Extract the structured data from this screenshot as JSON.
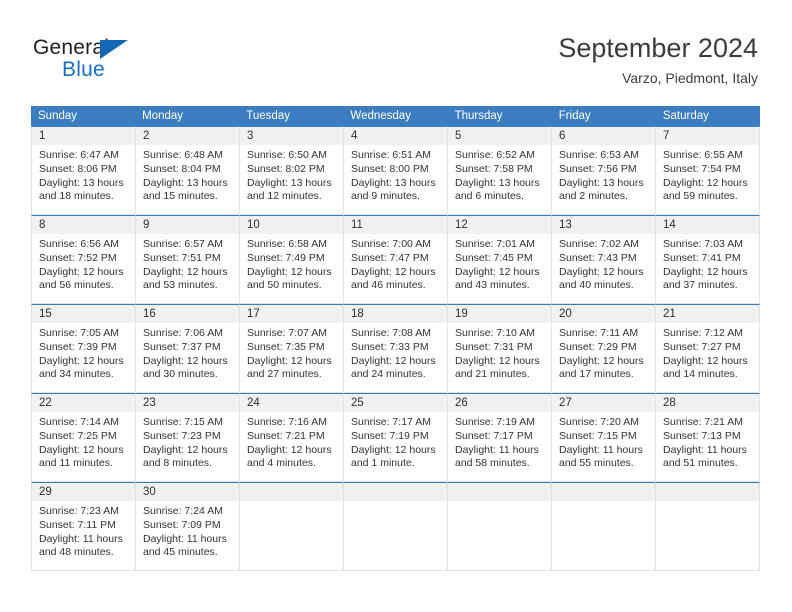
{
  "brand": {
    "name_part1": "General",
    "name_part2": "Blue",
    "triangle_color": "#1565b8"
  },
  "header": {
    "title": "September 2024",
    "location": "Varzo, Piedmont, Italy"
  },
  "colors": {
    "header_blue": "#3b7dc0",
    "daynum_band": "#f1f1f1",
    "border": "#e2e2e2"
  },
  "weekdays": [
    "Sunday",
    "Monday",
    "Tuesday",
    "Wednesday",
    "Thursday",
    "Friday",
    "Saturday"
  ],
  "weeks": [
    [
      {
        "day": "1",
        "sunrise": "Sunrise: 6:47 AM",
        "sunset": "Sunset: 8:06 PM",
        "daylight1": "Daylight: 13 hours",
        "daylight2": "and 18 minutes."
      },
      {
        "day": "2",
        "sunrise": "Sunrise: 6:48 AM",
        "sunset": "Sunset: 8:04 PM",
        "daylight1": "Daylight: 13 hours",
        "daylight2": "and 15 minutes."
      },
      {
        "day": "3",
        "sunrise": "Sunrise: 6:50 AM",
        "sunset": "Sunset: 8:02 PM",
        "daylight1": "Daylight: 13 hours",
        "daylight2": "and 12 minutes."
      },
      {
        "day": "4",
        "sunrise": "Sunrise: 6:51 AM",
        "sunset": "Sunset: 8:00 PM",
        "daylight1": "Daylight: 13 hours",
        "daylight2": "and 9 minutes."
      },
      {
        "day": "5",
        "sunrise": "Sunrise: 6:52 AM",
        "sunset": "Sunset: 7:58 PM",
        "daylight1": "Daylight: 13 hours",
        "daylight2": "and 6 minutes."
      },
      {
        "day": "6",
        "sunrise": "Sunrise: 6:53 AM",
        "sunset": "Sunset: 7:56 PM",
        "daylight1": "Daylight: 13 hours",
        "daylight2": "and 2 minutes."
      },
      {
        "day": "7",
        "sunrise": "Sunrise: 6:55 AM",
        "sunset": "Sunset: 7:54 PM",
        "daylight1": "Daylight: 12 hours",
        "daylight2": "and 59 minutes."
      }
    ],
    [
      {
        "day": "8",
        "sunrise": "Sunrise: 6:56 AM",
        "sunset": "Sunset: 7:52 PM",
        "daylight1": "Daylight: 12 hours",
        "daylight2": "and 56 minutes."
      },
      {
        "day": "9",
        "sunrise": "Sunrise: 6:57 AM",
        "sunset": "Sunset: 7:51 PM",
        "daylight1": "Daylight: 12 hours",
        "daylight2": "and 53 minutes."
      },
      {
        "day": "10",
        "sunrise": "Sunrise: 6:58 AM",
        "sunset": "Sunset: 7:49 PM",
        "daylight1": "Daylight: 12 hours",
        "daylight2": "and 50 minutes."
      },
      {
        "day": "11",
        "sunrise": "Sunrise: 7:00 AM",
        "sunset": "Sunset: 7:47 PM",
        "daylight1": "Daylight: 12 hours",
        "daylight2": "and 46 minutes."
      },
      {
        "day": "12",
        "sunrise": "Sunrise: 7:01 AM",
        "sunset": "Sunset: 7:45 PM",
        "daylight1": "Daylight: 12 hours",
        "daylight2": "and 43 minutes."
      },
      {
        "day": "13",
        "sunrise": "Sunrise: 7:02 AM",
        "sunset": "Sunset: 7:43 PM",
        "daylight1": "Daylight: 12 hours",
        "daylight2": "and 40 minutes."
      },
      {
        "day": "14",
        "sunrise": "Sunrise: 7:03 AM",
        "sunset": "Sunset: 7:41 PM",
        "daylight1": "Daylight: 12 hours",
        "daylight2": "and 37 minutes."
      }
    ],
    [
      {
        "day": "15",
        "sunrise": "Sunrise: 7:05 AM",
        "sunset": "Sunset: 7:39 PM",
        "daylight1": "Daylight: 12 hours",
        "daylight2": "and 34 minutes."
      },
      {
        "day": "16",
        "sunrise": "Sunrise: 7:06 AM",
        "sunset": "Sunset: 7:37 PM",
        "daylight1": "Daylight: 12 hours",
        "daylight2": "and 30 minutes."
      },
      {
        "day": "17",
        "sunrise": "Sunrise: 7:07 AM",
        "sunset": "Sunset: 7:35 PM",
        "daylight1": "Daylight: 12 hours",
        "daylight2": "and 27 minutes."
      },
      {
        "day": "18",
        "sunrise": "Sunrise: 7:08 AM",
        "sunset": "Sunset: 7:33 PM",
        "daylight1": "Daylight: 12 hours",
        "daylight2": "and 24 minutes."
      },
      {
        "day": "19",
        "sunrise": "Sunrise: 7:10 AM",
        "sunset": "Sunset: 7:31 PM",
        "daylight1": "Daylight: 12 hours",
        "daylight2": "and 21 minutes."
      },
      {
        "day": "20",
        "sunrise": "Sunrise: 7:11 AM",
        "sunset": "Sunset: 7:29 PM",
        "daylight1": "Daylight: 12 hours",
        "daylight2": "and 17 minutes."
      },
      {
        "day": "21",
        "sunrise": "Sunrise: 7:12 AM",
        "sunset": "Sunset: 7:27 PM",
        "daylight1": "Daylight: 12 hours",
        "daylight2": "and 14 minutes."
      }
    ],
    [
      {
        "day": "22",
        "sunrise": "Sunrise: 7:14 AM",
        "sunset": "Sunset: 7:25 PM",
        "daylight1": "Daylight: 12 hours",
        "daylight2": "and 11 minutes."
      },
      {
        "day": "23",
        "sunrise": "Sunrise: 7:15 AM",
        "sunset": "Sunset: 7:23 PM",
        "daylight1": "Daylight: 12 hours",
        "daylight2": "and 8 minutes."
      },
      {
        "day": "24",
        "sunrise": "Sunrise: 7:16 AM",
        "sunset": "Sunset: 7:21 PM",
        "daylight1": "Daylight: 12 hours",
        "daylight2": "and 4 minutes."
      },
      {
        "day": "25",
        "sunrise": "Sunrise: 7:17 AM",
        "sunset": "Sunset: 7:19 PM",
        "daylight1": "Daylight: 12 hours",
        "daylight2": "and 1 minute."
      },
      {
        "day": "26",
        "sunrise": "Sunrise: 7:19 AM",
        "sunset": "Sunset: 7:17 PM",
        "daylight1": "Daylight: 11 hours",
        "daylight2": "and 58 minutes."
      },
      {
        "day": "27",
        "sunrise": "Sunrise: 7:20 AM",
        "sunset": "Sunset: 7:15 PM",
        "daylight1": "Daylight: 11 hours",
        "daylight2": "and 55 minutes."
      },
      {
        "day": "28",
        "sunrise": "Sunrise: 7:21 AM",
        "sunset": "Sunset: 7:13 PM",
        "daylight1": "Daylight: 11 hours",
        "daylight2": "and 51 minutes."
      }
    ],
    [
      {
        "day": "29",
        "sunrise": "Sunrise: 7:23 AM",
        "sunset": "Sunset: 7:11 PM",
        "daylight1": "Daylight: 11 hours",
        "daylight2": "and 48 minutes."
      },
      {
        "day": "30",
        "sunrise": "Sunrise: 7:24 AM",
        "sunset": "Sunset: 7:09 PM",
        "daylight1": "Daylight: 11 hours",
        "daylight2": "and 45 minutes."
      },
      {
        "day": "",
        "sunrise": "",
        "sunset": "",
        "daylight1": "",
        "daylight2": ""
      },
      {
        "day": "",
        "sunrise": "",
        "sunset": "",
        "daylight1": "",
        "daylight2": ""
      },
      {
        "day": "",
        "sunrise": "",
        "sunset": "",
        "daylight1": "",
        "daylight2": ""
      },
      {
        "day": "",
        "sunrise": "",
        "sunset": "",
        "daylight1": "",
        "daylight2": ""
      },
      {
        "day": "",
        "sunrise": "",
        "sunset": "",
        "daylight1": "",
        "daylight2": ""
      }
    ]
  ]
}
